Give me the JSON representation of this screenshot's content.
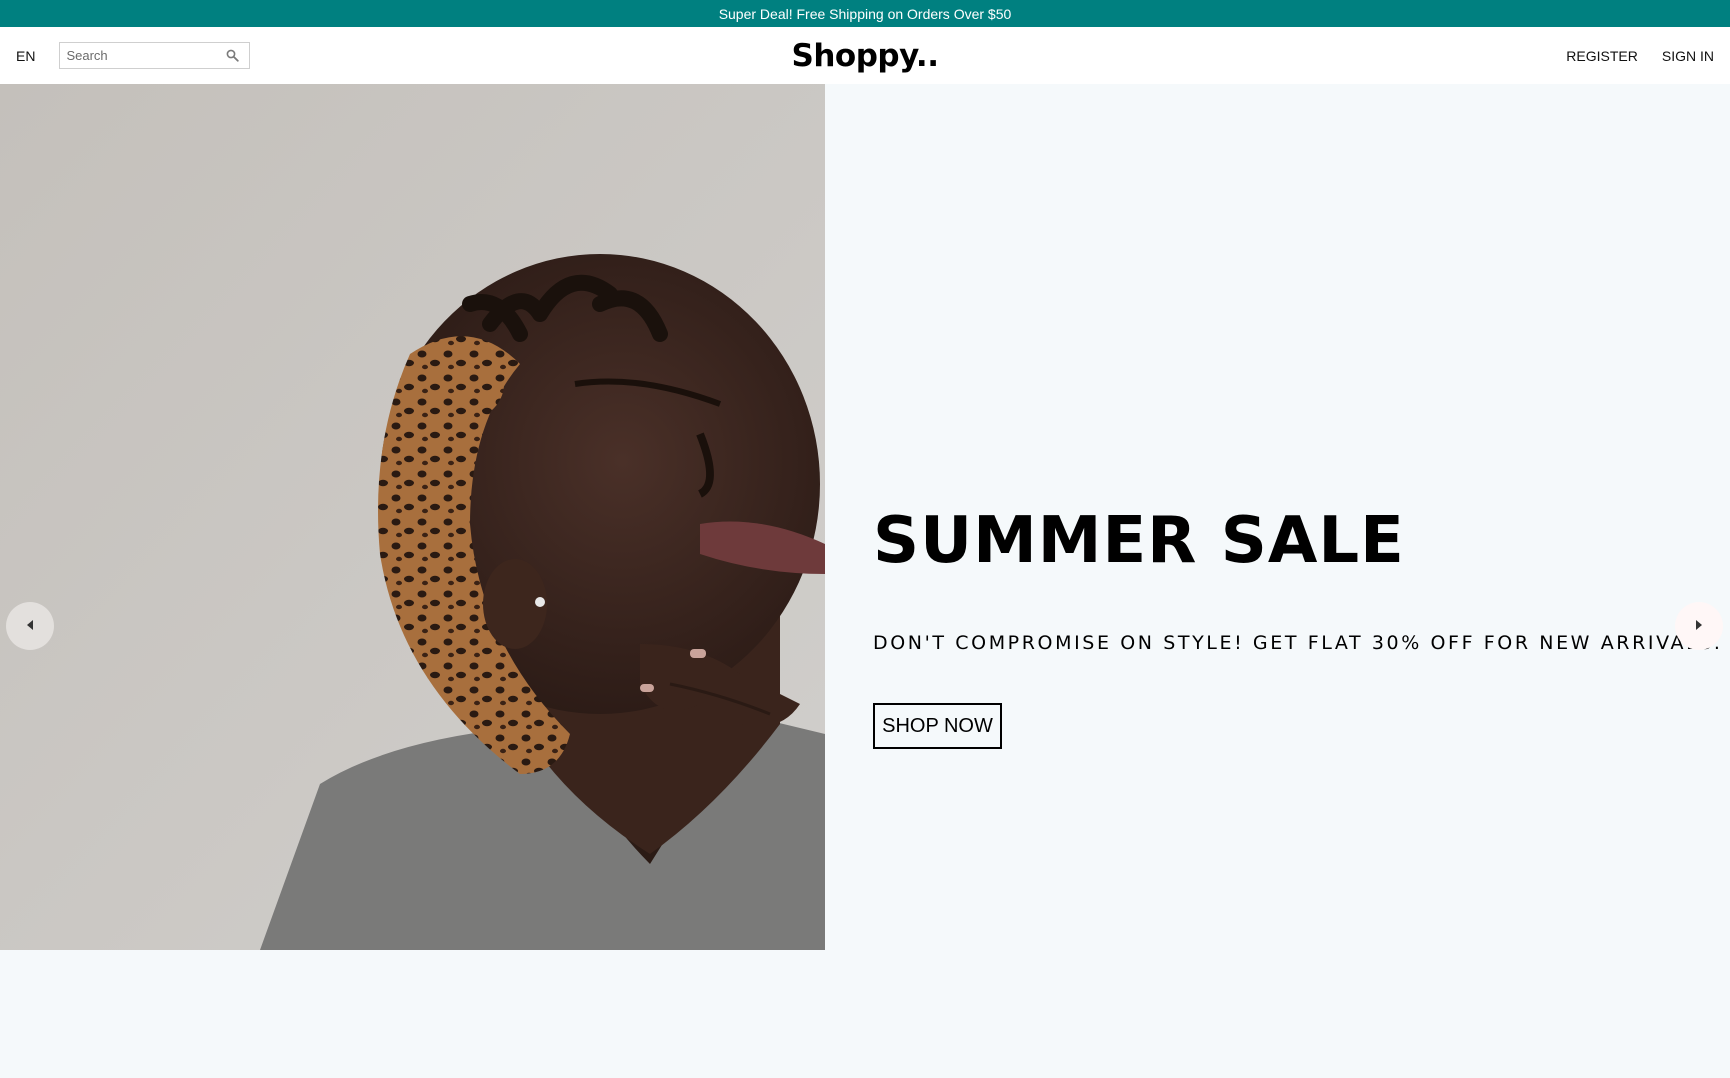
{
  "announcement": {
    "text": "Super Deal! Free Shipping on Orders Over $50",
    "bg_color": "#008080"
  },
  "navbar": {
    "language": "EN",
    "search": {
      "placeholder": "Search",
      "value": "",
      "icon": "search-icon"
    },
    "logo": "Shoppy..",
    "links": [
      "REGISTER",
      "SIGN IN"
    ]
  },
  "slider": {
    "background_color": "#f5f9fb",
    "slide": {
      "image": "woman-looking-up-photo",
      "title": "SUMMER SALE",
      "description": "DON'T COMPROMISE ON STYLE! GET FLAT 30% OFF FOR NEW ARRIVALS.",
      "button_label": "SHOP NOW"
    },
    "arrows": {
      "left": "arrow-left-icon",
      "right": "arrow-right-icon"
    }
  }
}
